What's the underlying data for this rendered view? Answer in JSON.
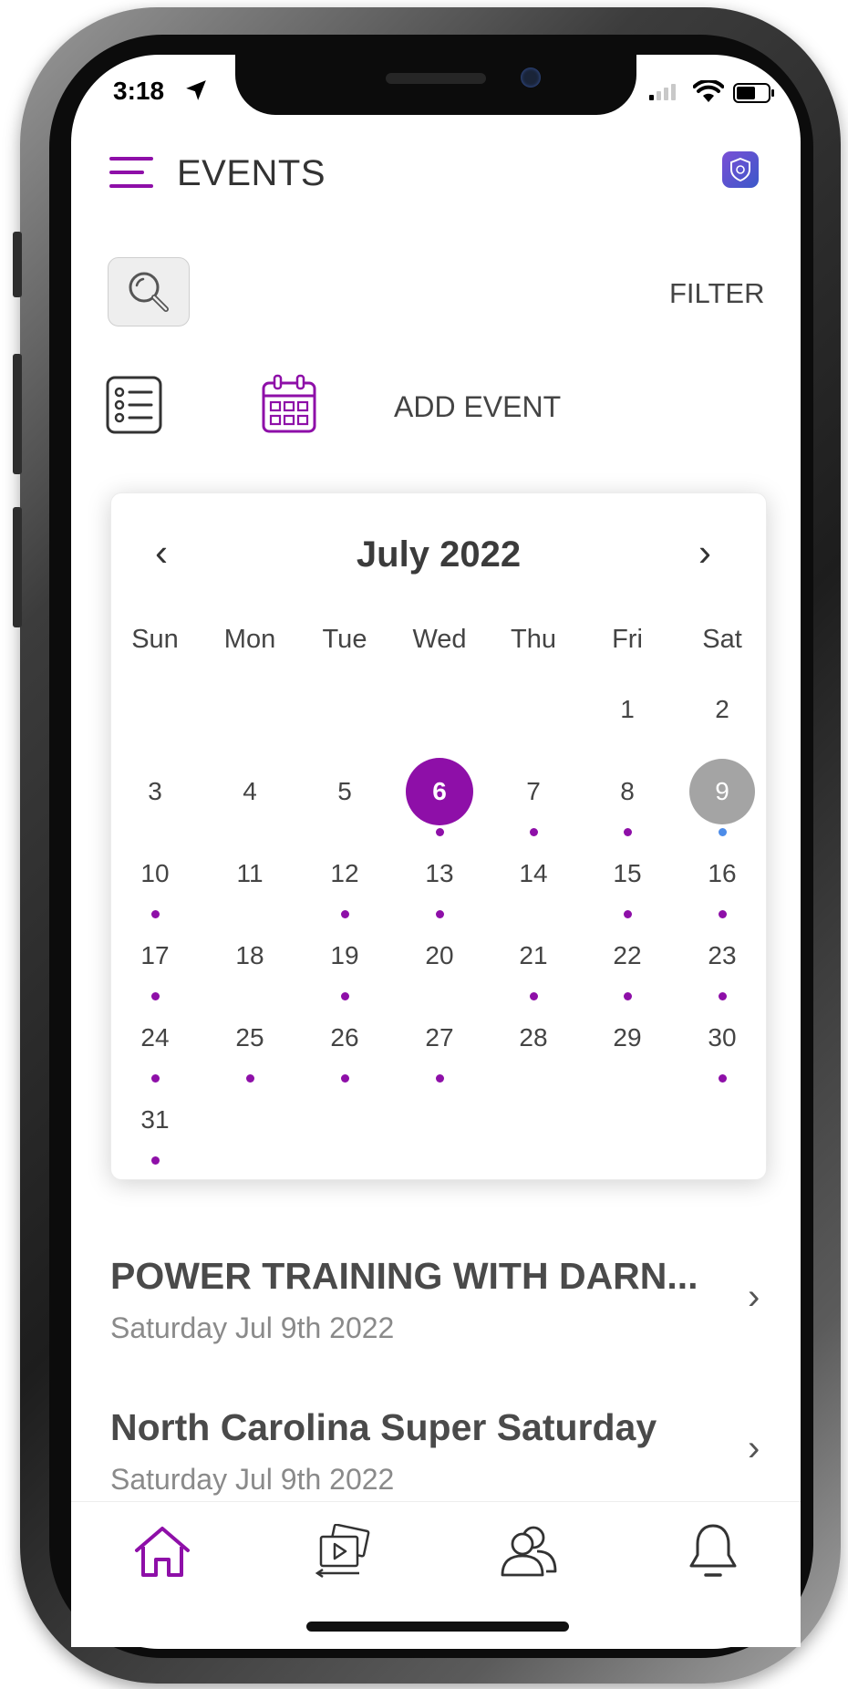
{
  "status_bar": {
    "time": "3:18"
  },
  "header": {
    "title": "EVENTS",
    "filter_label": "FILTER",
    "add_event_label": "ADD EVENT"
  },
  "calendar": {
    "month_label": "July 2022",
    "prev_label": "‹",
    "next_label": "›",
    "weekdays": [
      "Sun",
      "Mon",
      "Tue",
      "Wed",
      "Thu",
      "Fri",
      "Sat"
    ],
    "first_weekday_index": 5,
    "days_in_month": 31,
    "selected_day": 6,
    "today": 9,
    "event_days": [
      6,
      7,
      8,
      10,
      12,
      13,
      15,
      16,
      17,
      19,
      21,
      22,
      23,
      24,
      25,
      26,
      27,
      30,
      31
    ],
    "today_dot_color": "#4d8ce8",
    "accent_color": "#8e0fa8"
  },
  "events": [
    {
      "title": "POWER TRAINING WITH DARN...",
      "date": "Saturday Jul 9th 2022"
    },
    {
      "title": "North Carolina Super Saturday",
      "date": "Saturday Jul 9th 2022"
    }
  ],
  "tab_bar": {
    "items": [
      "home-icon",
      "media-icon",
      "people-icon",
      "bell-icon"
    ],
    "active": "home-icon"
  },
  "colors": {
    "accent": "#8e0fa8",
    "text": "#444444",
    "muted": "#8a8a8a"
  }
}
